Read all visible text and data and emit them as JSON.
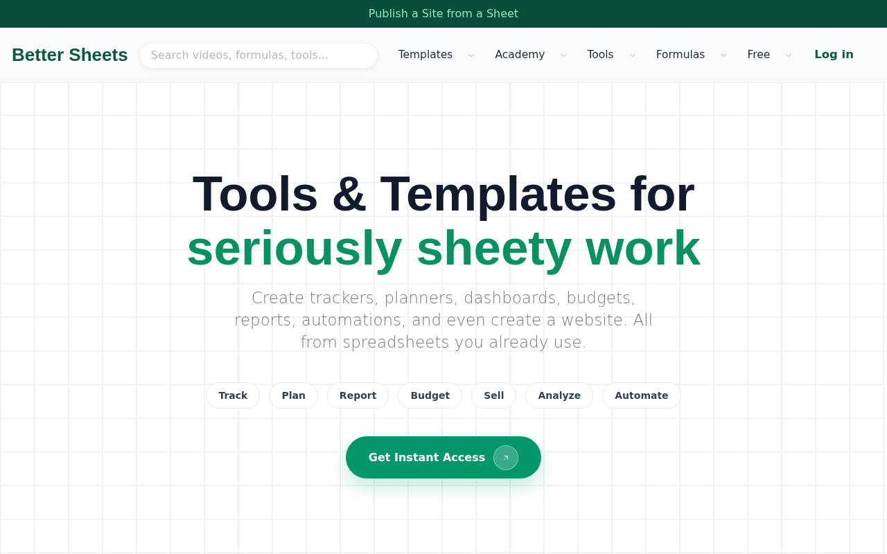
{
  "banner": {
    "text": "Publish a Site from a Sheet"
  },
  "header": {
    "logo": "Better Sheets",
    "search": {
      "placeholder": "Search videos, formulas, tools..."
    },
    "nav": [
      "Templates",
      "Academy",
      "Tools",
      "Formulas",
      "Free"
    ],
    "login": "Log in"
  },
  "hero": {
    "title": "Tools & Templates for",
    "highlight": "seriously sheety work",
    "subtitle": "Create trackers, planners, dashboards, budgets, reports, automations, and even create a website. All from spreadsheets you already use.",
    "tags": [
      "Track",
      "Plan",
      "Report",
      "Budget",
      "Sell",
      "Analyze",
      "Automate"
    ],
    "cta": "Get Instant Access"
  }
}
